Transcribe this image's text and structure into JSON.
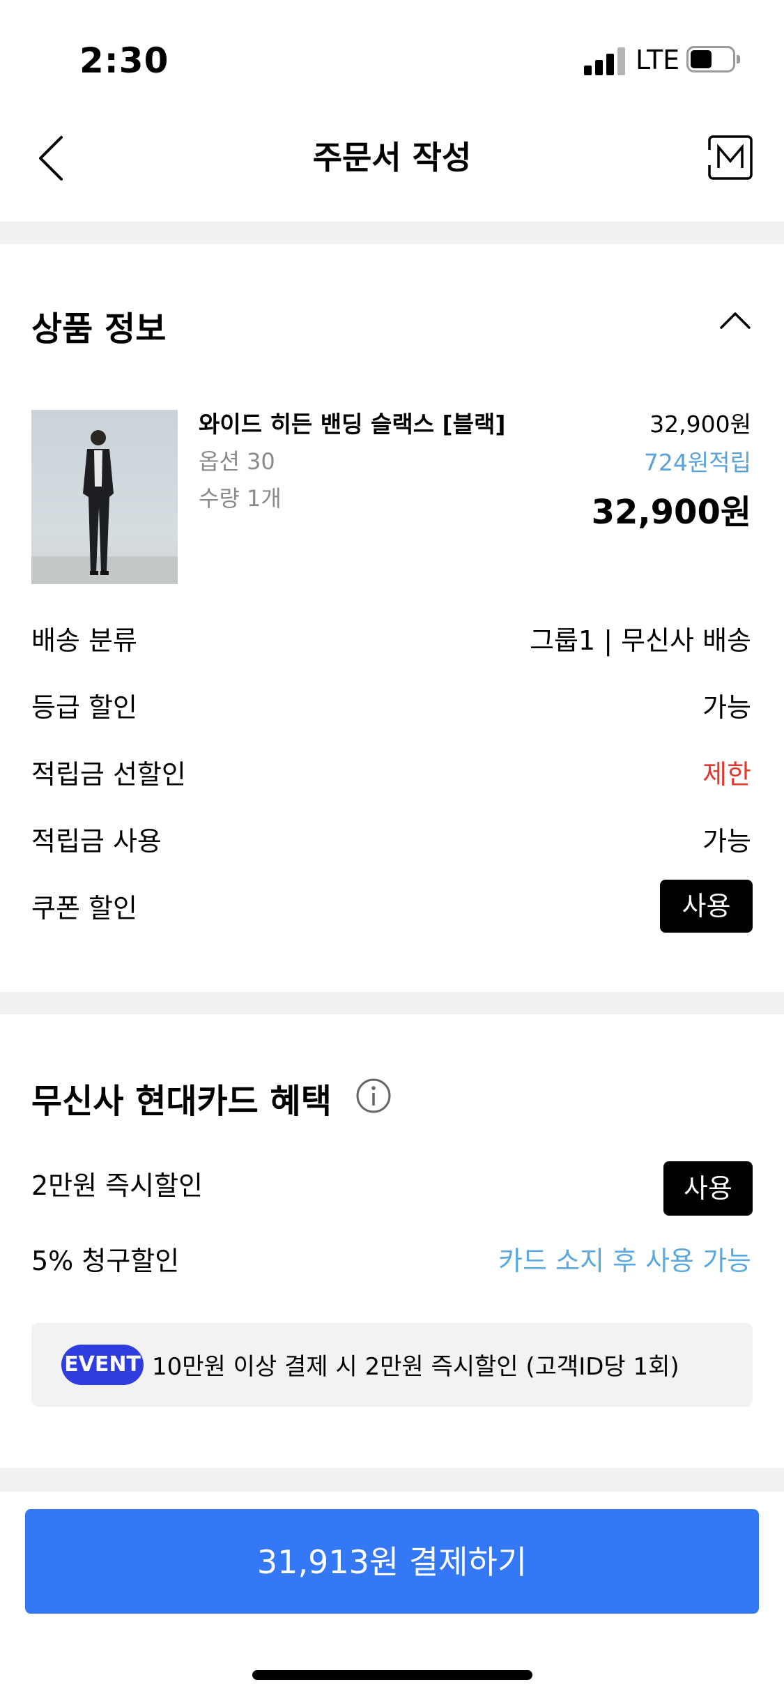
{
  "status_bar": {
    "time": "2:30",
    "network": "LTE"
  },
  "header": {
    "title": "주문서 작성",
    "icons": [
      "chevron-left-icon",
      "m-icon"
    ]
  },
  "product_section": {
    "title": "상품 정보",
    "product": {
      "name": "와이드 히든 밴딩 슬랙스 [블랙]",
      "option": "옵션 30",
      "quantity": "수량 1개",
      "price": "32,900원",
      "points": "724원적립",
      "final_price": "32,900원"
    },
    "rows": [
      {
        "label": "배송 분류",
        "value": "그룹1 | 무신사 배송"
      },
      {
        "label": "등급 할인",
        "value": "가능"
      },
      {
        "label": "적립금 선할인",
        "value": "제한",
        "color": "#e03a2e"
      },
      {
        "label": "적립금 사용",
        "value": "가능"
      },
      {
        "label": "쿠폰 할인",
        "button": "사용"
      }
    ]
  },
  "card_section": {
    "title": "무신사 현대카드 혜택",
    "rows": [
      {
        "label": "2만원 즉시할인",
        "button": "사용"
      },
      {
        "label": "5% 청구할인",
        "value": "카드 소지 후 사용 가능",
        "color": "#5aa8e0"
      }
    ],
    "event": {
      "badge": "EVENT",
      "text": "10만원 이상 결제 시 2만원 즉시할인 (고객ID당 1회)"
    }
  },
  "pay_button": {
    "label": "31,913원 결제하기",
    "color": "#3478f6"
  }
}
